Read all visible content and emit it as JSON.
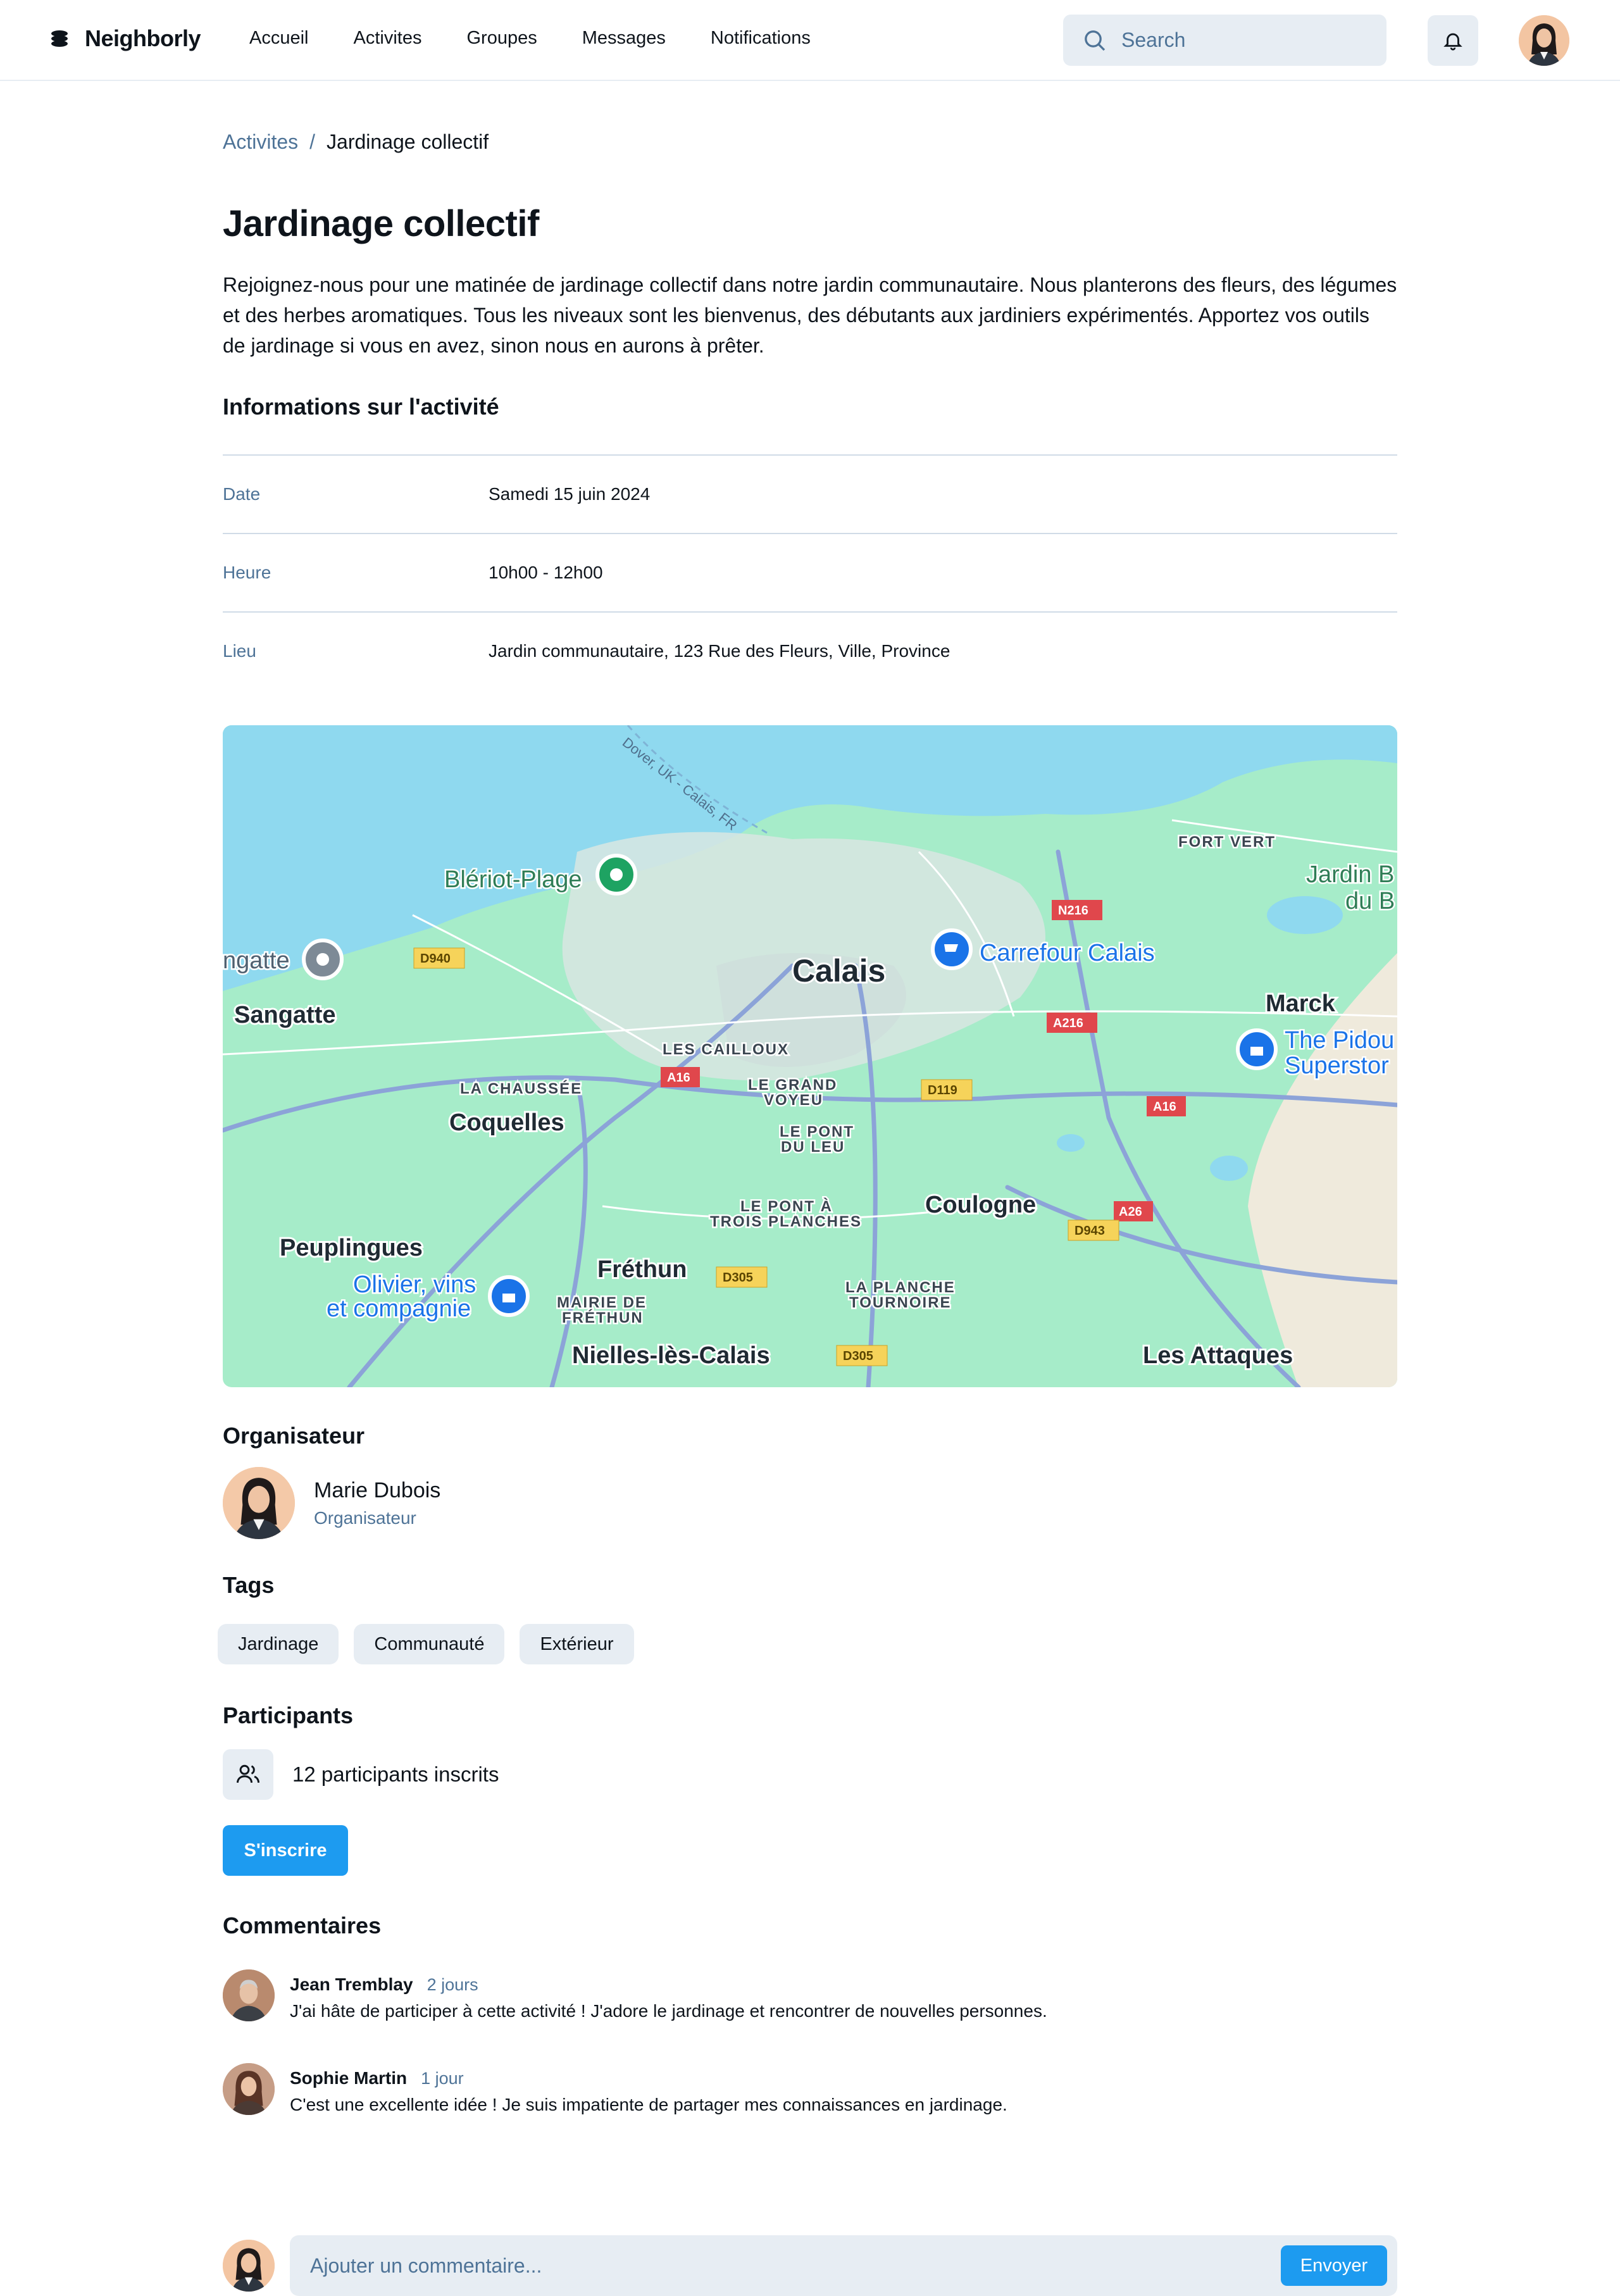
{
  "app": {
    "name": "Neighborly"
  },
  "nav": {
    "items": [
      "Accueil",
      "Activites",
      "Groupes",
      "Messages",
      "Notifications"
    ]
  },
  "search": {
    "placeholder": "Search"
  },
  "breadcrumb": {
    "parent": "Activites",
    "separator": "/",
    "current": "Jardinage collectif"
  },
  "activity": {
    "title": "Jardinage collectif",
    "description": "Rejoignez-nous pour une matinée de jardinage collectif dans notre jardin communautaire. Nous planterons des fleurs, des légumes et des herbes aromatiques. Tous les niveaux sont les bienvenus, des débutants aux jardiniers expérimentés. Apportez vos outils de jardinage si vous en avez, sinon nous en aurons à prêter."
  },
  "info": {
    "heading": "Informations sur l'activité",
    "rows": [
      {
        "label": "Date",
        "value": "Samedi 15 juin 2024"
      },
      {
        "label": "Heure",
        "value": "10h00 - 12h00"
      },
      {
        "label": "Lieu",
        "value": "Jardin communautaire, 123 Rue des Fleurs, Ville, Province"
      }
    ]
  },
  "map": {
    "labels": {
      "calais": "Calais",
      "blerio": "Blériot-Plage",
      "sangatte": "Sangatte",
      "sangatte_cut": "ngatte",
      "coquelles": "Coquelles",
      "chaussee": "LA CHAUSSÉE",
      "cailloux": "LES CAILLOUX",
      "grand_voyeu_1": "LE GRAND",
      "grand_voyeu_2": "VOYEU",
      "pont_leu_1": "LE PONT",
      "pont_leu_2": "DU LEU",
      "pont_trois_1": "LE PONT À",
      "pont_trois_2": "TROIS PLANCHES",
      "coulogne": "Coulogne",
      "marck": "Marck",
      "fort_vert": "FORT VERT",
      "jardin_1": "Jardin B",
      "jardin_2": "du B",
      "carrefour": "Carrefour Calais",
      "pidou_1": "The Pidou",
      "pidou_2": "Superstor",
      "peuplingues": "Peuplingues",
      "olivier_1": "Olivier, vins",
      "olivier_2": "et compagnie",
      "frethun": "Fréthun",
      "mairie_1": "MAIRIE DE",
      "mairie_2": "FRÉTHUN",
      "nielles": "Nielles-lès-Calais",
      "planche_1": "LA PLANCHE",
      "planche_2": "TOURNOIRE",
      "attaques": "Les Attaques",
      "ferry": "Dover, UK - Calais, FR",
      "d940": "D940",
      "n216": "N216",
      "a216": "A216",
      "a16a": "A16",
      "a16b": "A16",
      "d119": "D119",
      "a26": "A26",
      "d943": "D943",
      "d305a": "D305",
      "d305b": "D305"
    }
  },
  "organizer": {
    "heading": "Organisateur",
    "name": "Marie Dubois",
    "role": "Organisateur"
  },
  "tags": {
    "heading": "Tags",
    "items": [
      "Jardinage",
      "Communauté",
      "Extérieur"
    ]
  },
  "participants": {
    "heading": "Participants",
    "text": "12 participants inscrits",
    "button": "S'inscrire"
  },
  "comments": {
    "heading": "Commentaires",
    "items": [
      {
        "name": "Jean Tremblay",
        "time": "2 jours",
        "text": "J'ai hâte de participer à cette activité ! J'adore le jardinage et rencontrer de nouvelles personnes."
      },
      {
        "name": "Sophie Martin",
        "time": "1 jour",
        "text": "C'est une excellente idée ! Je suis impatiente de partager mes connaissances en jardinage."
      }
    ],
    "input_placeholder": "Ajouter un commentaire...",
    "send": "Envoyer"
  },
  "colors": {
    "accent": "#1d9bf0",
    "muted": "#4e7397",
    "surface": "#e7edf3",
    "water": "#8fd9ef",
    "land": "#a6ecc9"
  }
}
